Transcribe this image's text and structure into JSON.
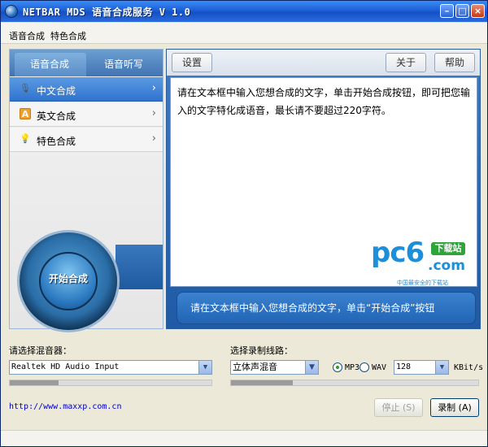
{
  "window": {
    "title": "NETBAR MDS 语音合成服务 V 1.0"
  },
  "menu": [
    "语音合成",
    "特色合成"
  ],
  "left": {
    "tabs": [
      "语音合成",
      "语音听写"
    ],
    "items": [
      {
        "label": "中文合成",
        "icon": "microphone-icon",
        "active": true
      },
      {
        "label": "英文合成",
        "icon": "letter-a-icon"
      },
      {
        "label": "特色合成",
        "icon": "bulb-icon"
      }
    ],
    "start_button": "开始合成"
  },
  "toolbar": {
    "settings": "设置",
    "about": "关于",
    "help": "帮助"
  },
  "main": {
    "instructions": "请在文本框中输入您想合成的文字，单击开始合成按钮，即可把您输入的文字特化成语音，最长请不要超过220字符。",
    "hint": "请在文本框中输入您想合成的文字，单击“开始合成”按钮",
    "watermark": {
      "brand": "pc6",
      "domain": ".com",
      "badge": "下载站",
      "tagline": "中国最安全的下载站"
    }
  },
  "audio": {
    "mixer_label": "请选择混音器：",
    "mixer_value": "Realtek HD Audio Input",
    "line_label": "选择录制线路：",
    "line_value": "立体声混音",
    "format_mp3": "MP3",
    "format_wav": "WAV",
    "format_selected": "MP3",
    "bitrate_value": "128",
    "bitrate_unit": "KBit/s",
    "mixer_level": 0.24,
    "line_level": 0.25
  },
  "footer": {
    "link": "http://www.maxxp.com.cn",
    "stop_button": "停止 (S)",
    "record_button": "录制 (A)"
  }
}
